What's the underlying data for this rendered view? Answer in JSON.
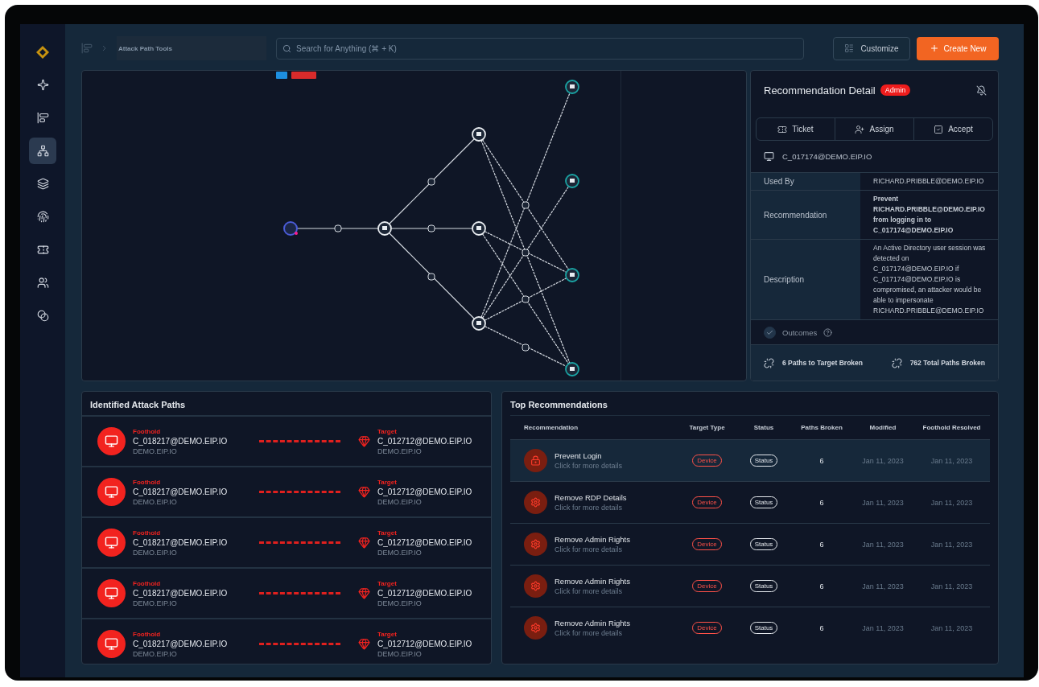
{
  "sidebar": {
    "items": [
      {
        "kind": "logo",
        "selected": false
      },
      {
        "kind": "sparkle",
        "selected": false
      },
      {
        "kind": "gantt",
        "selected": false
      },
      {
        "kind": "network",
        "selected": true
      },
      {
        "kind": "layers",
        "selected": false
      },
      {
        "kind": "fingerprint",
        "selected": false
      },
      {
        "kind": "ticket",
        "selected": false
      },
      {
        "kind": "users",
        "selected": false
      },
      {
        "kind": "circles",
        "selected": false
      }
    ]
  },
  "topbar": {
    "breadcrumb": "Attack Path Tools",
    "search": {
      "placeholder": "Search for Anything (⌘ + K)"
    },
    "customize": "Customize",
    "create": "Create New"
  },
  "detail": {
    "title": "Recommendation Detail",
    "badge": "Admin",
    "actions": [
      {
        "kind": "ticket",
        "label": "Ticket"
      },
      {
        "kind": "assign",
        "label": "Assign"
      },
      {
        "kind": "accept",
        "label": "Accept"
      }
    ],
    "device": "C_017174@DEMO.EIP.IO",
    "rows": [
      {
        "label": "Used By",
        "value": "RICHARD.PRIBBLE@DEMO.EIP.IO",
        "bold": false
      },
      {
        "label": "Recommendation",
        "value": "Prevent RICHARD.PRIBBLE@DEMO.EIP.IO from logging in to C_017174@DEMO.EIP.IO",
        "bold": true
      },
      {
        "label": "Description",
        "value": "An Active Directory user session was detected on C_017174@DEMO.EIP.IO if C_017174@DEMO.EIP.IO is compromised, an attacker would be able to impersonate RICHARD.PRIBBLE@DEMO.EIP.IO",
        "bold": false
      }
    ],
    "outcomes": {
      "label": "Outcomes",
      "checked": true
    },
    "stats": [
      "6 Paths to Target Broken",
      "762 Total Paths Broken"
    ]
  },
  "attack_paths": {
    "title": "Identified Attack Paths",
    "rows": [
      {
        "foothold_label": "Foothold",
        "foothold": "C_018217@DEMO.EIP.IO",
        "foothold_domain": "DEMO.EIP.IO",
        "target_label": "Target",
        "target": "C_012712@DEMO.EIP.IO",
        "target_domain": "DEMO.EIP.IO"
      },
      {
        "foothold_label": "Foothold",
        "foothold": "C_018217@DEMO.EIP.IO",
        "foothold_domain": "DEMO.EIP.IO",
        "target_label": "Target",
        "target": "C_012712@DEMO.EIP.IO",
        "target_domain": "DEMO.EIP.IO"
      },
      {
        "foothold_label": "Foothold",
        "foothold": "C_018217@DEMO.EIP.IO",
        "foothold_domain": "DEMO.EIP.IO",
        "target_label": "Target",
        "target": "C_012712@DEMO.EIP.IO",
        "target_domain": "DEMO.EIP.IO"
      },
      {
        "foothold_label": "Foothold",
        "foothold": "C_018217@DEMO.EIP.IO",
        "foothold_domain": "DEMO.EIP.IO",
        "target_label": "Target",
        "target": "C_012712@DEMO.EIP.IO",
        "target_domain": "DEMO.EIP.IO"
      },
      {
        "foothold_label": "Foothold",
        "foothold": "C_018217@DEMO.EIP.IO",
        "foothold_domain": "DEMO.EIP.IO",
        "target_label": "Target",
        "target": "C_012712@DEMO.EIP.IO",
        "target_domain": "DEMO.EIP.IO"
      }
    ]
  },
  "recommendations": {
    "title": "Top Recommendations",
    "columns": [
      "Recommendation",
      "Target Type",
      "Status",
      "Paths Broken",
      "Modified",
      "Foothold Resolved"
    ],
    "rows": [
      {
        "kind": "login",
        "title": "Prevent Login",
        "subtitle": "Click for more details",
        "target_type": "Device",
        "status": "Status",
        "paths": "6",
        "modified": "Jan 11, 2023",
        "foothold_resolved": "Jan 11, 2023",
        "selected": true
      },
      {
        "kind": "settings",
        "title": "Remove RDP Details",
        "subtitle": "Click for more details",
        "target_type": "Device",
        "status": "Status",
        "paths": "6",
        "modified": "Jan 11, 2023",
        "foothold_resolved": "Jan 11, 2023",
        "selected": false
      },
      {
        "kind": "settings",
        "title": "Remove Admin Rights",
        "subtitle": "Click for more details",
        "target_type": "Device",
        "status": "Status",
        "paths": "6",
        "modified": "Jan 11, 2023",
        "foothold_resolved": "Jan 11, 2023",
        "selected": false
      },
      {
        "kind": "settings",
        "title": "Remove Admin Rights",
        "subtitle": "Click for more details",
        "target_type": "Device",
        "status": "Status",
        "paths": "6",
        "modified": "Jan 11, 2023",
        "foothold_resolved": "Jan 11, 2023",
        "selected": false
      },
      {
        "kind": "settings",
        "title": "Remove Admin Rights",
        "subtitle": "Click for more details",
        "target_type": "Device",
        "status": "Status",
        "paths": "6",
        "modified": "Jan 11, 2023",
        "foothold_resolved": "Jan 11, 2023",
        "selected": false
      }
    ]
  }
}
